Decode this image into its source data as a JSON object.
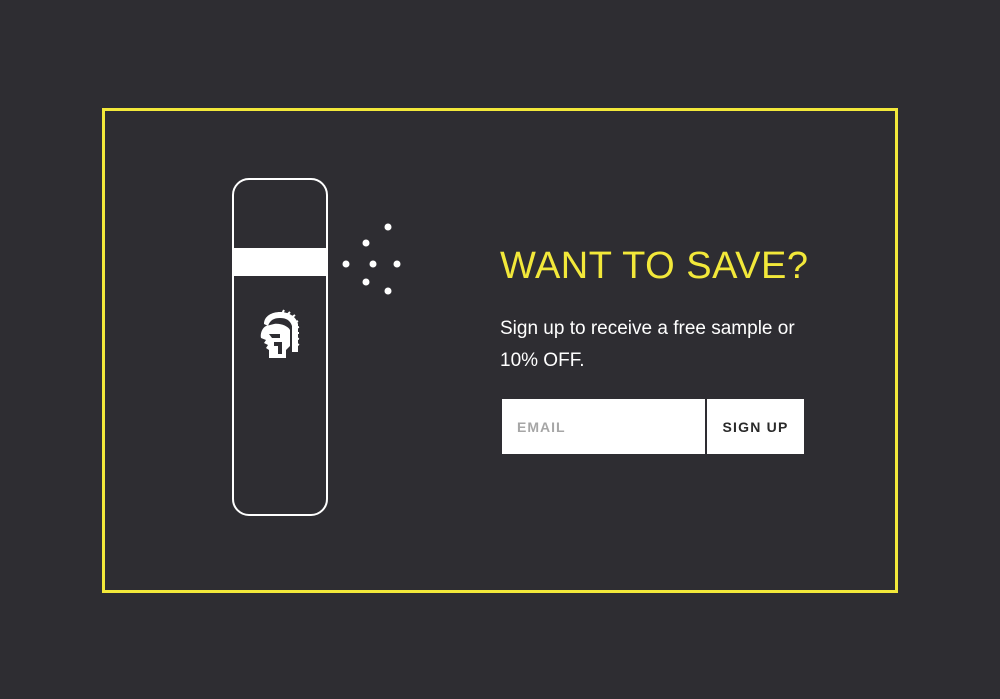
{
  "popup": {
    "headline": "WANT TO SAVE?",
    "subtext": "Sign up to receive a free sample or 10% OFF.",
    "email_placeholder": "EMAIL",
    "email_value": "",
    "signup_label": "SIGN UP"
  },
  "illustration": {
    "bottle_icon": "spray-bottle-icon",
    "logo_icon": "spartan-helmet-icon",
    "spray_icon": "spray-mist-icon"
  },
  "colors": {
    "background": "#2e2d32",
    "accent": "#f2e83a",
    "text": "#ffffff",
    "button_bg": "#ffffff",
    "button_text": "#2a2a2a"
  }
}
